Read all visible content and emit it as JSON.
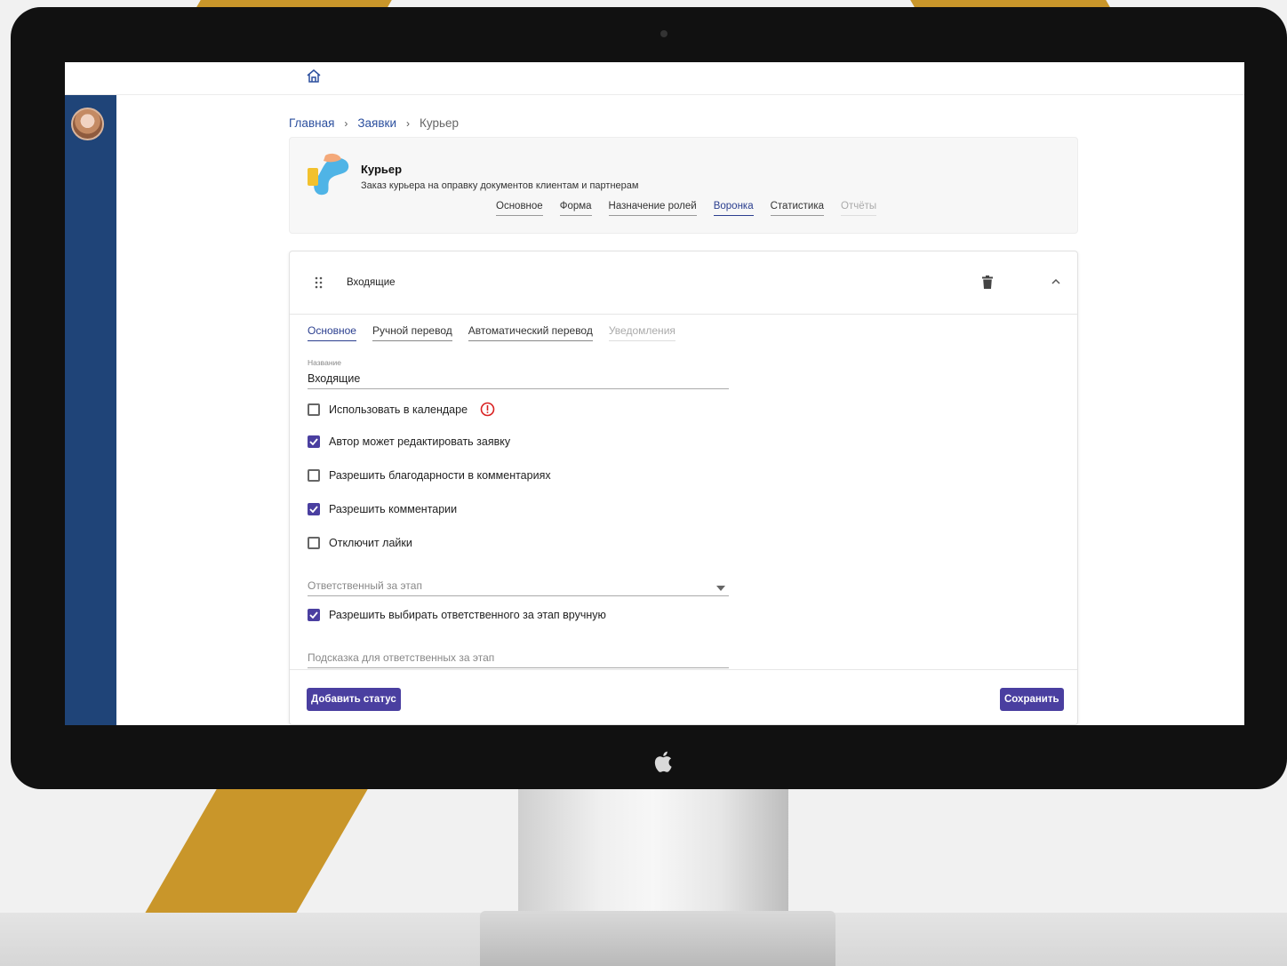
{
  "breadcrumb": {
    "home": "Главная",
    "requests": "Заявки",
    "current": "Курьер",
    "separator": "›"
  },
  "service": {
    "title": "Курьер",
    "description": "Заказ курьера на оправку документов клиентам и партнерам"
  },
  "tabs": [
    {
      "label": "Основное"
    },
    {
      "label": "Форма"
    },
    {
      "label": "Назначение ролей"
    },
    {
      "label": "Воронка"
    },
    {
      "label": "Статистика"
    },
    {
      "label": "Отчёты"
    }
  ],
  "status": {
    "name": "Входящие",
    "subtabs": [
      {
        "label": "Основное"
      },
      {
        "label": "Ручной перевод"
      },
      {
        "label": "Автоматический перевод"
      },
      {
        "label": "Уведомления"
      }
    ],
    "name_field": {
      "label": "Название",
      "value": "Входящие"
    },
    "checkboxes": [
      {
        "label": "Использовать в календаре",
        "checked": false
      },
      {
        "label": "Автор может редактировать заявку",
        "checked": true
      },
      {
        "label": "Разрешить благодарности в комментариях",
        "checked": false
      },
      {
        "label": "Разрешить комментарии",
        "checked": true
      },
      {
        "label": "Отключит лайки",
        "checked": false
      }
    ],
    "responsible_select": {
      "placeholder": "Ответственный за этап"
    },
    "manual_choice": {
      "label": "Разрешить выбирать ответственного за этап вручную",
      "checked": true
    },
    "hint_field": {
      "placeholder": "Подсказка для ответственных за этап"
    }
  },
  "footer": {
    "add_status": "Добавить статус",
    "save": "Сохранить"
  },
  "colors": {
    "sidebar": "#1f4478",
    "accent": "#4a3fa0",
    "link": "#2b4f9e",
    "warning": "#d92121",
    "backdrop_stripe": "#c9962a"
  },
  "icons": [
    "home-icon",
    "drag-handle-icon",
    "trash-icon",
    "chevron-up-icon",
    "warning-icon",
    "check-icon",
    "dropdown-arrow-icon",
    "apple-logo-icon"
  ]
}
